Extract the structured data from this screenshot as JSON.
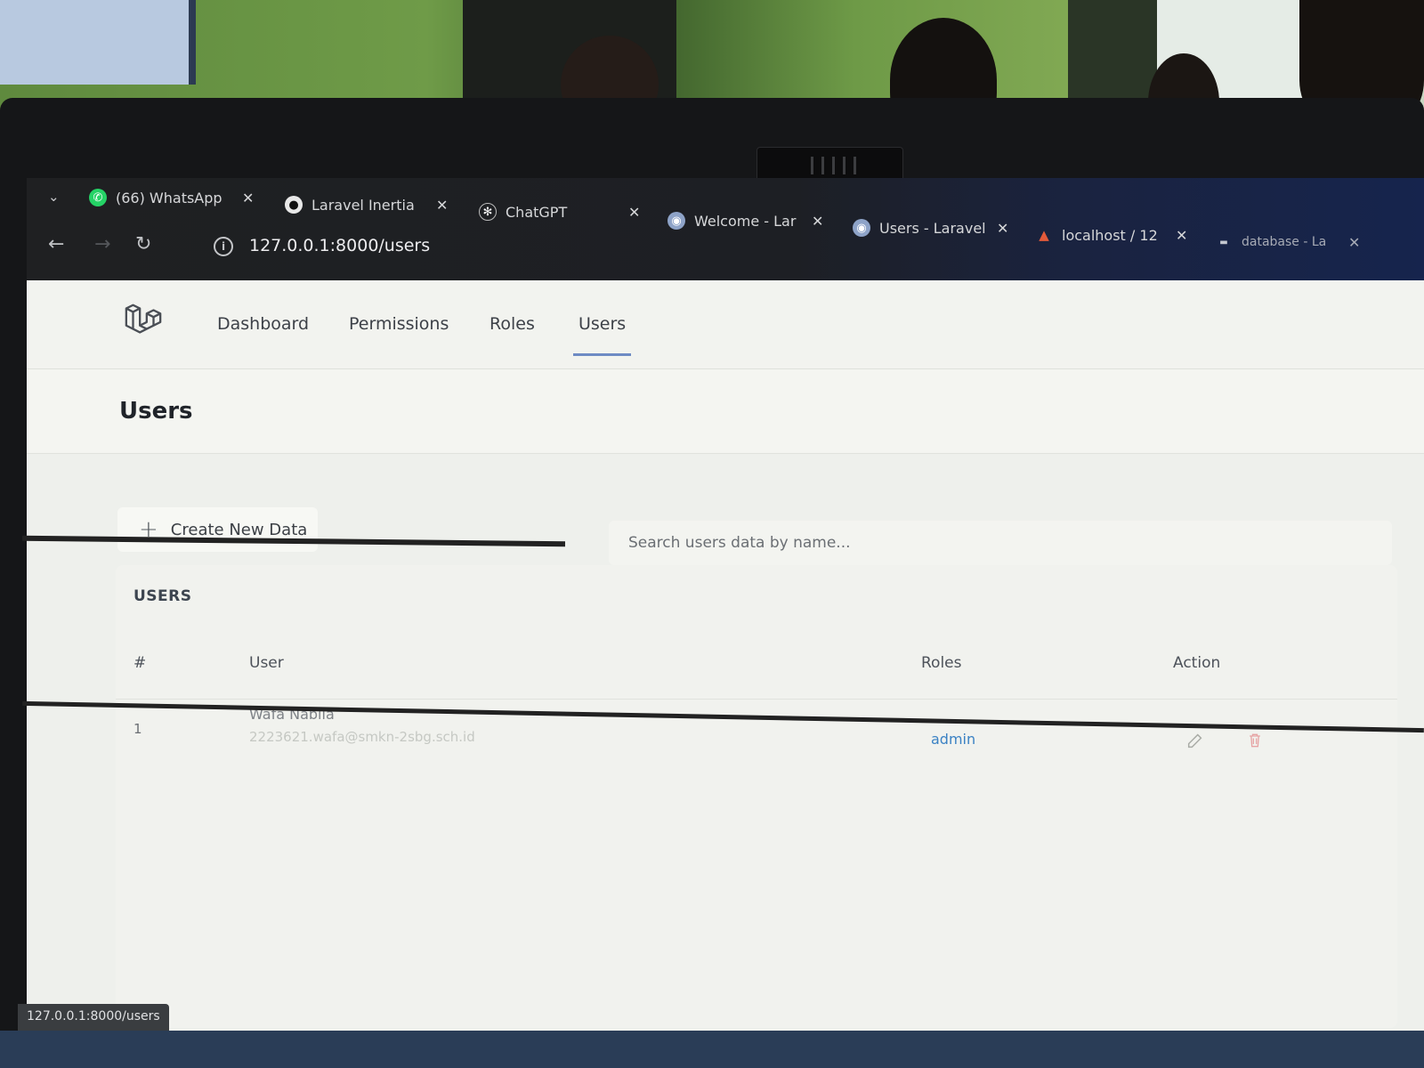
{
  "tabs": [
    {
      "label": "(66) WhatsApp",
      "icon": "whatsapp-icon"
    },
    {
      "label": "Laravel Inertia",
      "icon": "github-icon"
    },
    {
      "label": "ChatGPT",
      "icon": "openai-icon"
    },
    {
      "label": "Welcome - Lar",
      "icon": "globe-icon"
    },
    {
      "label": "Users - Laravel",
      "icon": "globe-icon"
    },
    {
      "label": "localhost / 12",
      "icon": "phpmyadmin-icon"
    },
    {
      "label": "database - La",
      "icon": "database-icon"
    }
  ],
  "address": {
    "url": "127.0.0.1:8000/users"
  },
  "nav": {
    "dashboard": "Dashboard",
    "permissions": "Permissions",
    "roles": "Roles",
    "users": "Users"
  },
  "page": {
    "title": "Users"
  },
  "toolbar": {
    "create_label": "Create New Data",
    "search_placeholder": "Search users data by name..."
  },
  "table": {
    "title": "USERS",
    "headers": {
      "num": "#",
      "user": "User",
      "roles": "Roles",
      "action": "Action"
    },
    "rows": [
      {
        "num": "1",
        "name": "Wafa Nabila",
        "email": "2223621.wafa@smkn-2sbg.sch.id",
        "role": "admin"
      }
    ]
  },
  "status_bar": {
    "url": "127.0.0.1:8000/users"
  },
  "colors": {
    "accent": "#6e8bc4",
    "role_link": "#3b82c4"
  }
}
